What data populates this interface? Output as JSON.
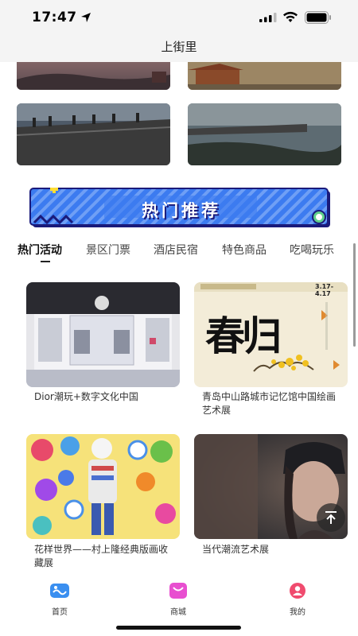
{
  "status": {
    "time": "17:47"
  },
  "header": {
    "title": "上街里"
  },
  "banner": {
    "text": "热门推荐",
    "colors": {
      "background": "#3c7bf0",
      "stripes": "#8fb6ff",
      "text": "#ffffff",
      "accent": "#ffdd33",
      "border": "#1a1a7a"
    }
  },
  "tabs": [
    {
      "label": "热门活动",
      "active": true
    },
    {
      "label": "景区门票",
      "active": false
    },
    {
      "label": "酒店民宿",
      "active": false
    },
    {
      "label": "特色商品",
      "active": false
    },
    {
      "label": "吃喝玩乐",
      "active": false
    }
  ],
  "cards": [
    {
      "title": "Dior潮玩+数字文化中国",
      "image": "dior-exhibition-photo"
    },
    {
      "title": "青岛中山路城市记忆馆中国绘画艺术展",
      "image": "spring-poster"
    },
    {
      "title": "花样世界——村上隆经典版画收藏展",
      "image": "murakami-flowers-photo"
    },
    {
      "title": "当代潮流艺术展",
      "image": "portrait-photo"
    }
  ],
  "poster": {
    "title": "春归",
    "date": "3.17-4.17"
  },
  "bottom_nav": [
    {
      "label": "首页",
      "icon": "home-icon",
      "color": "#3a8ff0"
    },
    {
      "label": "商城",
      "icon": "shop-icon",
      "color": "#e84fd0"
    },
    {
      "label": "我的",
      "icon": "profile-icon",
      "color": "#f04b6e"
    }
  ]
}
